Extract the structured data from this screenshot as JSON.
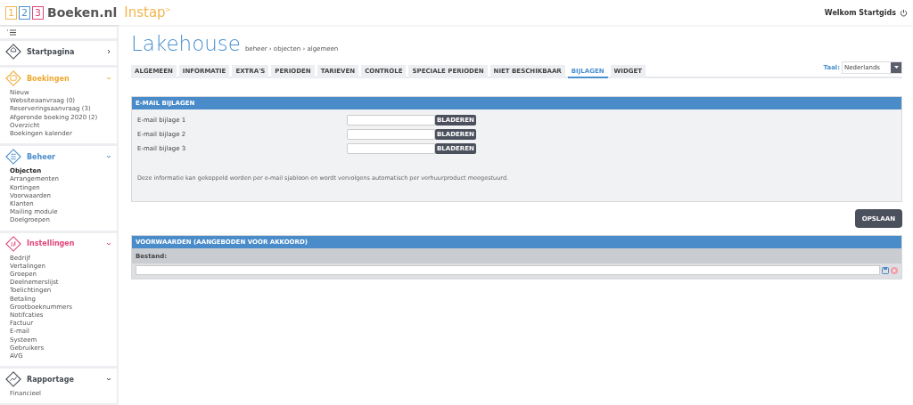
{
  "header": {
    "logo_digits": [
      "1",
      "2",
      "3"
    ],
    "logo_name": "Boeken.nl",
    "logo_product": "Instap",
    "logo_mark": ">",
    "welcome": "Welkom Startgids"
  },
  "sidebar": {
    "sections": [
      {
        "title": "Startpagina",
        "kind": "home",
        "color": "#444a52",
        "expanded": false
      },
      {
        "title": "Boekingen",
        "kind": "bookings",
        "color": "#f0a830",
        "expanded": true,
        "items": [
          {
            "label": "Nieuw",
            "selected": false
          },
          {
            "label": "Websiteaanvraag (0)",
            "selected": false
          },
          {
            "label": "Reserveringsaanvraag (3)",
            "selected": false
          },
          {
            "label": "Afgeronde boeking 2020 (2)",
            "selected": false
          },
          {
            "label": "Overzicht",
            "selected": false
          },
          {
            "label": "Boekingen kalender",
            "selected": false
          }
        ]
      },
      {
        "title": "Beheer",
        "kind": "manage",
        "color": "#4a8cc9",
        "expanded": true,
        "items": [
          {
            "label": "Objecten",
            "selected": true
          },
          {
            "label": "Arrangementen",
            "selected": false
          },
          {
            "label": "Kortingen",
            "selected": false
          },
          {
            "label": "Voorwaarden",
            "selected": false
          },
          {
            "label": "Klanten",
            "selected": false
          },
          {
            "label": "Mailing module",
            "selected": false
          },
          {
            "label": "Doelgroepen",
            "selected": false
          }
        ]
      },
      {
        "title": "Instellingen",
        "kind": "settings",
        "color": "#e0457a",
        "expanded": true,
        "items": [
          {
            "label": "Bedrijf",
            "selected": false
          },
          {
            "label": "Vertalingen",
            "selected": false
          },
          {
            "label": "Groepen",
            "selected": false
          },
          {
            "label": "Deelnemerslijst",
            "selected": false
          },
          {
            "label": "Toelichtingen",
            "selected": false
          },
          {
            "label": "Betaling",
            "selected": false
          },
          {
            "label": "Grootboeknummers",
            "selected": false
          },
          {
            "label": "Notifcaties",
            "selected": false
          },
          {
            "label": "Factuur",
            "selected": false
          },
          {
            "label": "E-mail",
            "selected": false
          },
          {
            "label": "Systeem",
            "selected": false
          },
          {
            "label": "Gebruikers",
            "selected": false
          },
          {
            "label": "AVG",
            "selected": false
          }
        ]
      },
      {
        "title": "Rapportage",
        "kind": "report",
        "color": "#444a52",
        "expanded": true,
        "items": [
          {
            "label": "Financieel",
            "selected": false
          }
        ]
      }
    ]
  },
  "page": {
    "title": "Lakehouse",
    "breadcrumb": "beheer › objecten › algemeen"
  },
  "tabs": [
    {
      "label": "ALGEMEEN",
      "selected": false
    },
    {
      "label": "INFORMATIE",
      "selected": false
    },
    {
      "label": "EXTRA'S",
      "selected": false
    },
    {
      "label": "PERIODEN",
      "selected": false
    },
    {
      "label": "TARIEVEN",
      "selected": false
    },
    {
      "label": "CONTROLE",
      "selected": false
    },
    {
      "label": "SPECIALE PERIODEN",
      "selected": false
    },
    {
      "label": "NIET BESCHIKBAAR",
      "selected": false
    },
    {
      "label": "BIJLAGEN",
      "selected": true
    },
    {
      "label": "WIDGET",
      "selected": false
    }
  ],
  "language": {
    "label": "Taal:",
    "value": "Nederlands"
  },
  "attachments": {
    "title": "E-MAIL BIJLAGEN",
    "rows": [
      {
        "label": "E-mail bijlage 1",
        "button": "BLADEREN"
      },
      {
        "label": "E-mail bijlage 2",
        "button": "BLADEREN"
      },
      {
        "label": "E-mail bijlage 3",
        "button": "BLADEREN"
      }
    ],
    "note": "Deze informatie kan gekoppeld worden per e-mail sjabloon en wordt vervolgens automatisch per verhuurproduct meegestuurd."
  },
  "save_button": "OPSLAAN",
  "terms": {
    "title": "VOORWAARDEN (AANGEBODEN VOOR AKKOORD)",
    "field_label": "Bestand:"
  }
}
